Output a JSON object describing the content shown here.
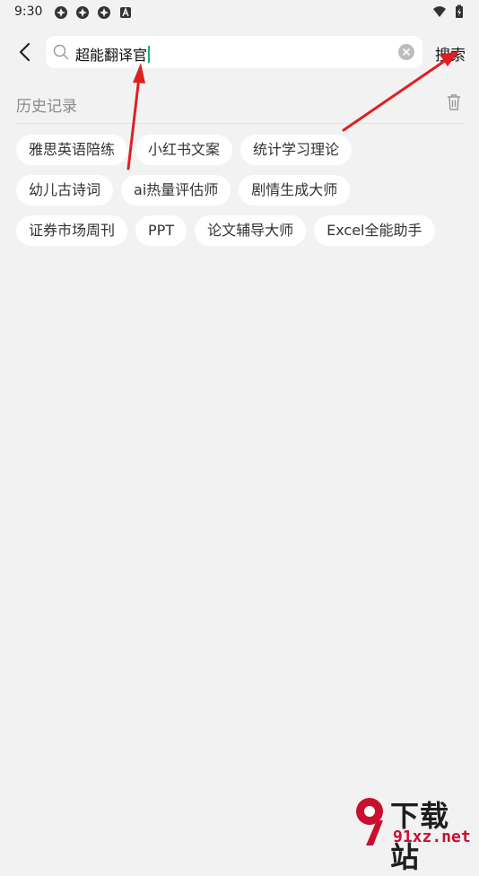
{
  "status_bar": {
    "time": "9:30",
    "left_icons": [
      "app-icon",
      "app-icon",
      "app-icon",
      "font-icon"
    ],
    "right_icons": [
      "wifi-icon",
      "battery-icon"
    ]
  },
  "search": {
    "query": "超能翻译官",
    "button_label": "搜索"
  },
  "history": {
    "title": "历史记录",
    "rows": [
      [
        "雅思英语陪练",
        "小红书文案",
        "统计学习理论"
      ],
      [
        "幼儿古诗词",
        "ai热量评估师",
        "剧情生成大师"
      ],
      [
        "证券市场周刊",
        "PPT",
        "论文辅导大师",
        "Excel全能助手"
      ]
    ]
  },
  "watermark": {
    "name": "下载站",
    "site": "91xz.net"
  },
  "colors": {
    "background": "#f2f2f2",
    "caret": "#1aad7a",
    "annotation_arrow": "#e02020"
  }
}
